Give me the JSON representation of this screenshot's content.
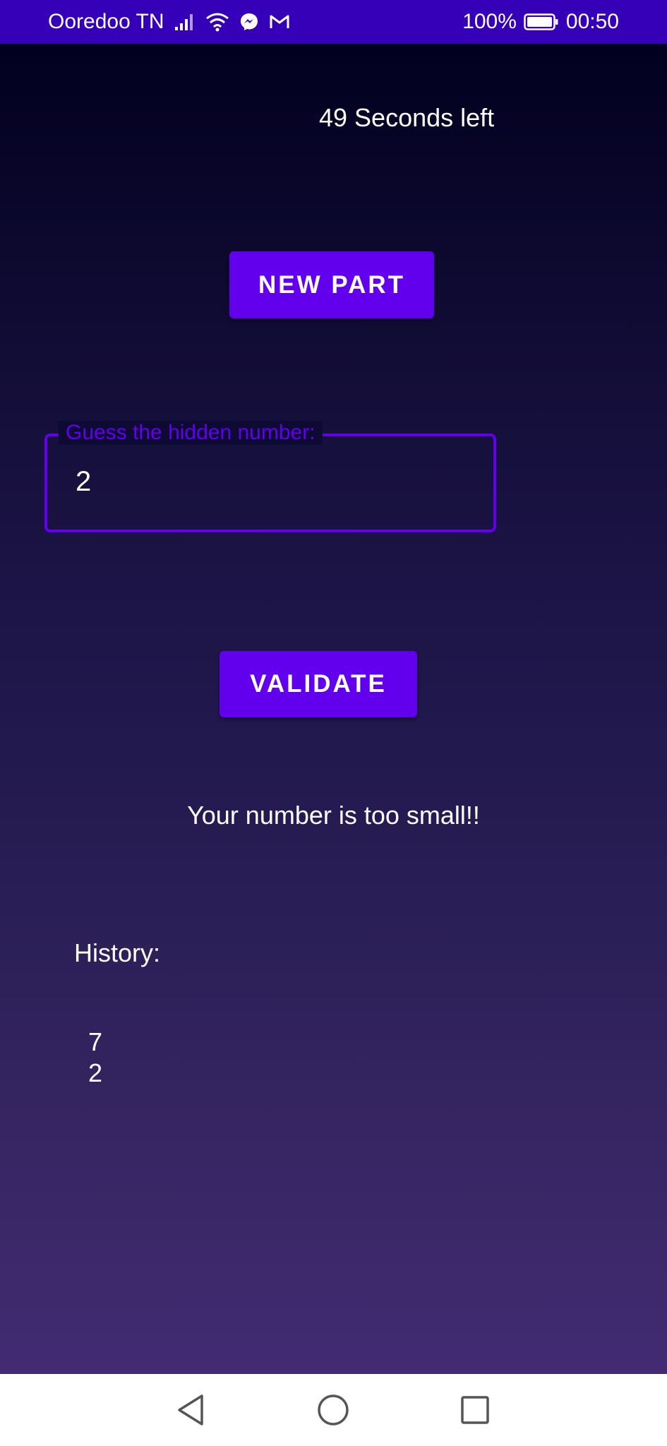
{
  "status_bar": {
    "carrier": "Ooredoo TN",
    "battery": "100%",
    "time": "00:50",
    "icons": [
      "signal-icon",
      "wifi-icon",
      "messenger-icon",
      "gmail-icon",
      "battery-icon"
    ]
  },
  "game": {
    "timer_text": "49 Seconds left",
    "new_part_label": "NEW PART",
    "input_label": "Guess the hidden number:",
    "input_value": "2",
    "validate_label": "VALIDATE",
    "message": "Your number is too small!!",
    "history_label": "History:",
    "history": [
      "7",
      "2"
    ]
  },
  "nav_bar": {
    "icons": [
      "back-icon",
      "home-icon",
      "recents-icon"
    ]
  },
  "colors": {
    "accent": "#6200ee",
    "status_bar": "#3500b8",
    "background_top": "#02001f",
    "background_bottom": "#432b72"
  }
}
